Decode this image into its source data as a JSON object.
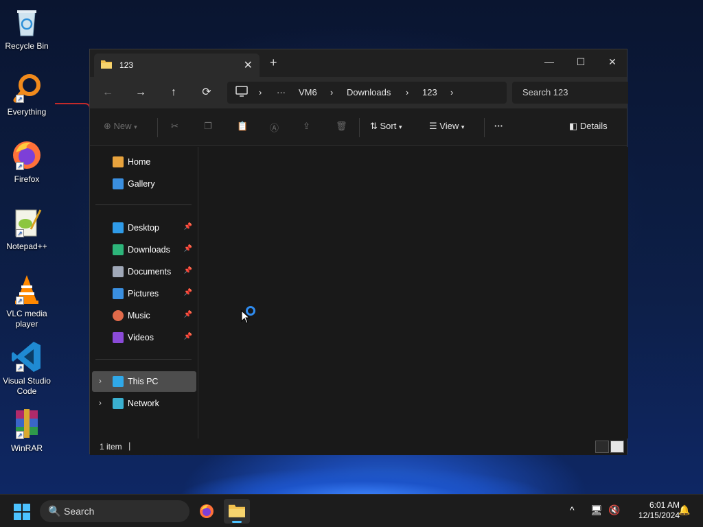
{
  "desktop": {
    "icons": [
      {
        "label": "Recycle Bin",
        "icon": "recycle-bin-icon"
      },
      {
        "label": "Everything",
        "icon": "everything-search-icon"
      },
      {
        "label": "Firefox",
        "icon": "firefox-icon"
      },
      {
        "label": "Notepad++",
        "icon": "notepad-plus-plus-icon"
      },
      {
        "label": "VLC media player",
        "icon": "vlc-icon"
      },
      {
        "label": "Visual Studio Code",
        "icon": "vscode-icon"
      },
      {
        "label": "WinRAR",
        "icon": "winrar-icon"
      }
    ]
  },
  "window": {
    "tab_title": "123",
    "tab_close": "✕",
    "new_tab": "+",
    "controls": {
      "minimize": "—",
      "maximize": "☐",
      "close": "✕"
    },
    "nav": {
      "back": "←",
      "forward": "→",
      "up": "↑",
      "refresh": "⟳"
    },
    "breadcrumb": {
      "ellipsis": "···",
      "items": [
        "VM6",
        "Downloads",
        "123"
      ],
      "separator": "›"
    },
    "search_placeholder": "Search 123",
    "toolbar": {
      "new_label": "New",
      "sort_label": "Sort",
      "view_label": "View",
      "more_label": "···",
      "details_label": "Details"
    },
    "sidebar": {
      "quick": [
        {
          "label": "Home",
          "icon": "home-icon",
          "color": "#e8a33d"
        },
        {
          "label": "Gallery",
          "icon": "gallery-icon",
          "color": "#3a8fe0"
        }
      ],
      "pinned": [
        {
          "label": "Desktop",
          "icon": "desktop-icon",
          "color": "#2f9be8"
        },
        {
          "label": "Downloads",
          "icon": "downloads-icon",
          "color": "#2db57a"
        },
        {
          "label": "Documents",
          "icon": "documents-icon",
          "color": "#a0a8b8"
        },
        {
          "label": "Pictures",
          "icon": "pictures-icon",
          "color": "#3a8fe0"
        },
        {
          "label": "Music",
          "icon": "music-icon",
          "color": "#e06a4a"
        },
        {
          "label": "Videos",
          "icon": "videos-icon",
          "color": "#8a4ad8"
        }
      ],
      "pin_glyph": "📌",
      "devices": [
        {
          "label": "This PC",
          "icon": "this-pc-icon",
          "color": "#2fa8e8",
          "selected": true
        },
        {
          "label": "Network",
          "icon": "network-icon",
          "color": "#3ab0d0",
          "selected": false
        }
      ],
      "chevron": "›"
    },
    "status": {
      "item_count": "1 item",
      "caret": "|"
    }
  },
  "taskbar": {
    "search_label": "Search",
    "search_icon": "🔍",
    "apps": [
      {
        "name": "firefox",
        "icon": "firefox-icon"
      },
      {
        "name": "file-explorer",
        "icon": "file-explorer-icon",
        "active": true
      }
    ],
    "tray": {
      "chevron": "^",
      "network": "🖥",
      "volume": "🔇"
    },
    "time": "6:01 AM",
    "date": "12/15/2024",
    "accent": "#4cc2ff"
  }
}
